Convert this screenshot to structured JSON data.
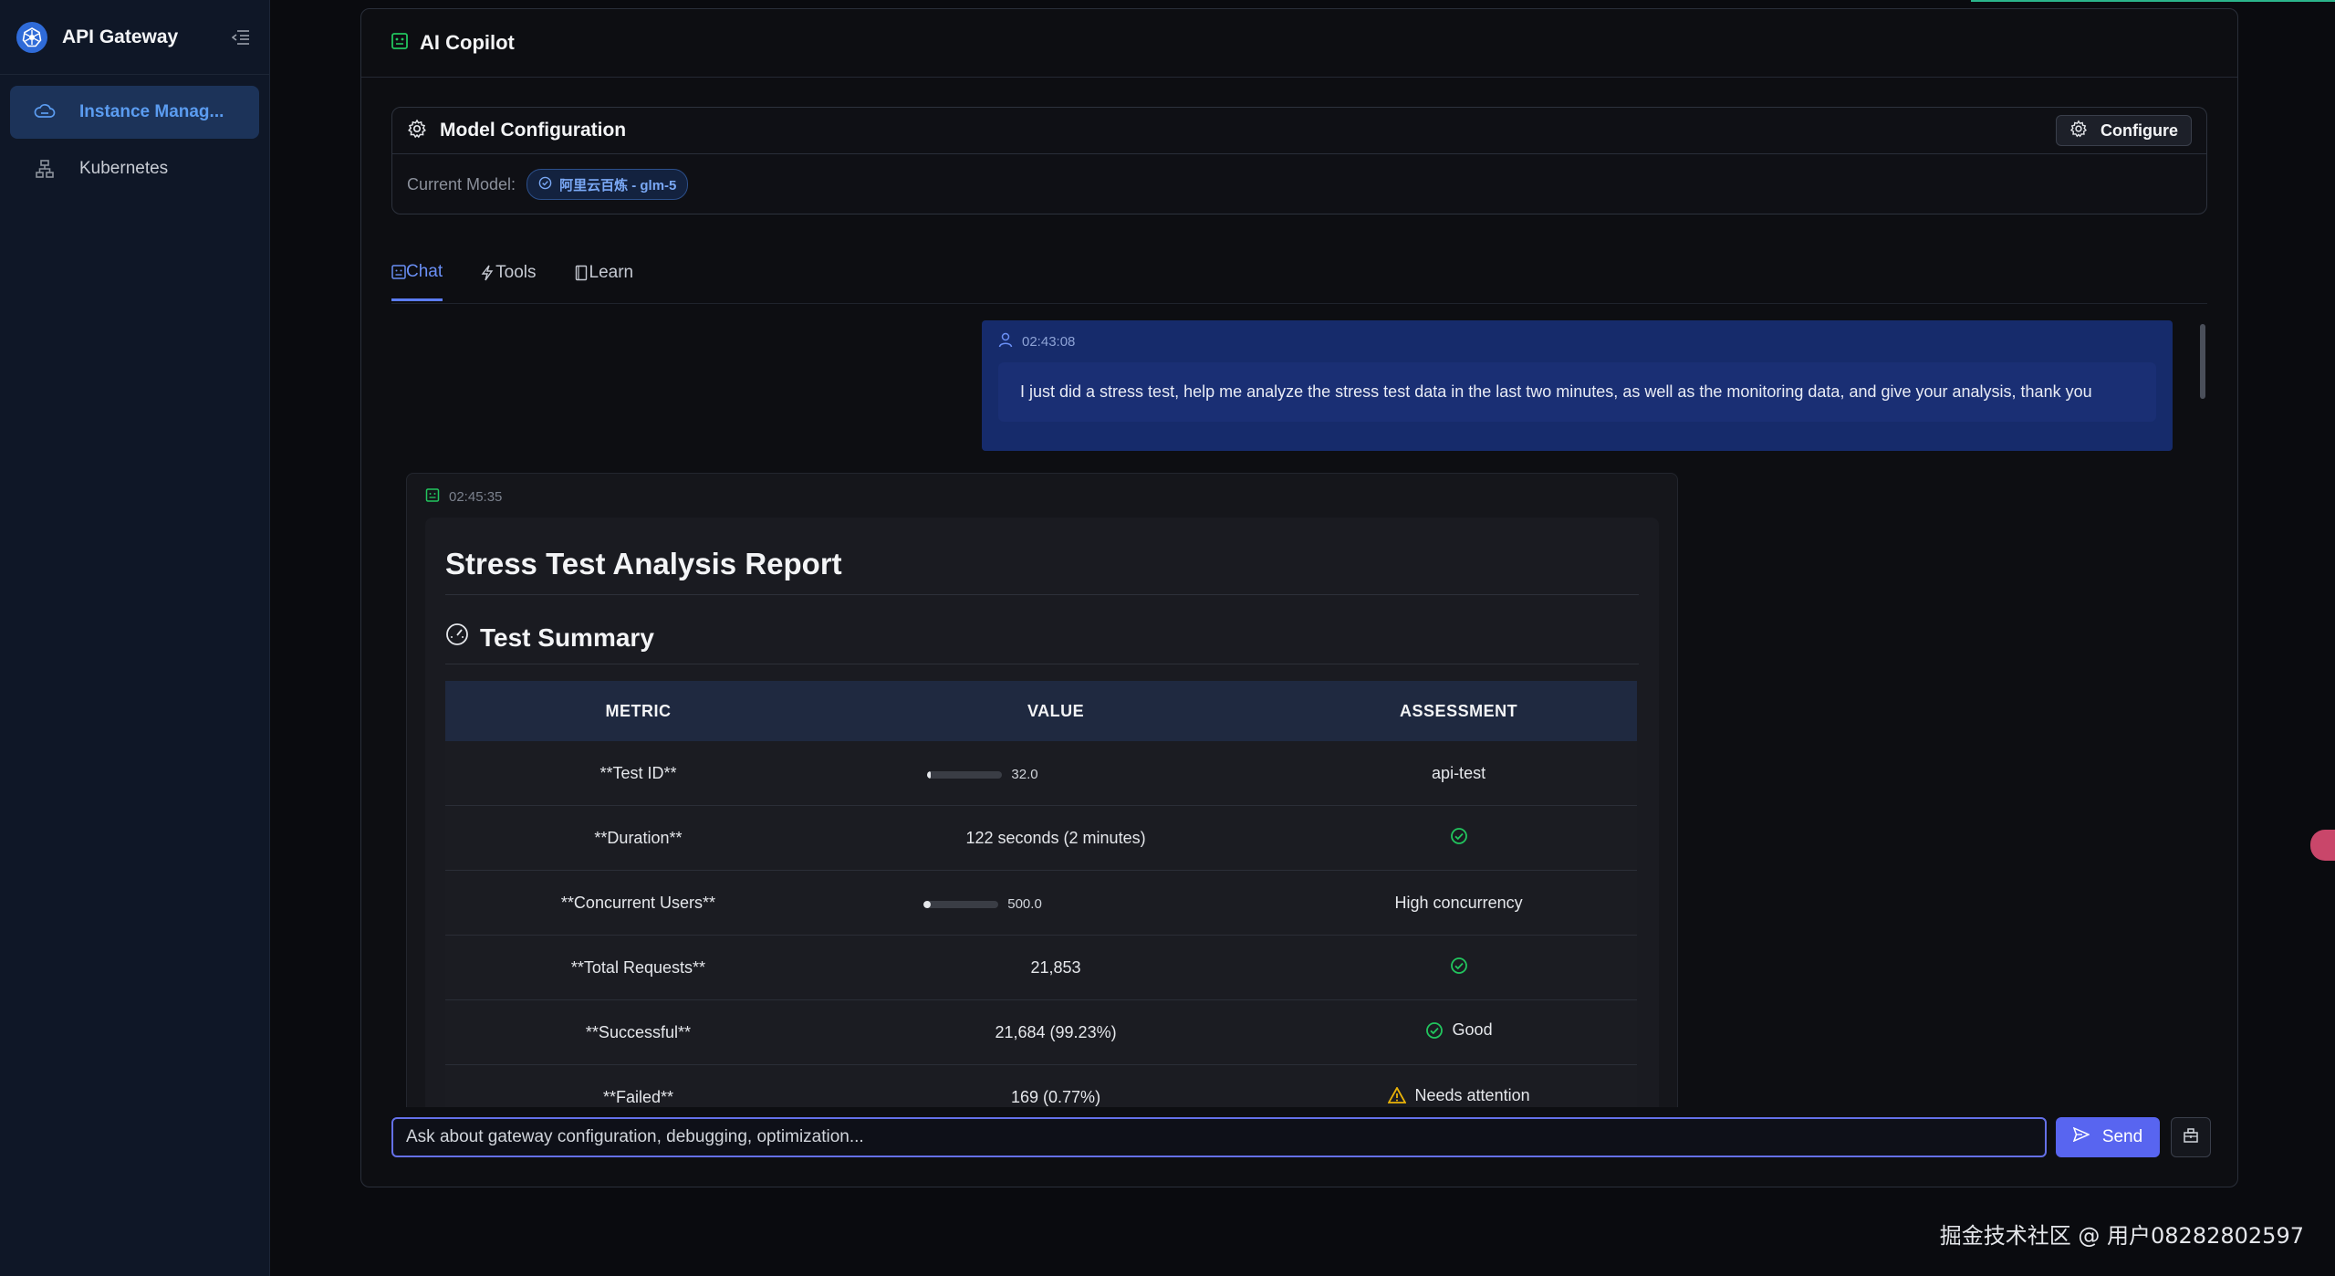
{
  "app": {
    "title": "API Gateway",
    "accent": "#5865f0"
  },
  "sidebar": {
    "items": [
      {
        "label": "Instance Manag...",
        "icon": "cloud-icon",
        "active": true
      },
      {
        "label": "Kubernetes",
        "icon": "cluster-icon",
        "active": false
      }
    ]
  },
  "panel": {
    "title": "AI Copilot"
  },
  "model_config": {
    "title": "Model Configuration",
    "configure_label": "Configure",
    "current_label": "Current Model:",
    "current_model": "阿里云百炼 - glm-5"
  },
  "tabs": [
    {
      "label": "Chat",
      "active": true
    },
    {
      "label": "Tools",
      "active": false
    },
    {
      "label": "Learn",
      "active": false
    }
  ],
  "messages": {
    "user": {
      "time": "02:43:08",
      "text": "I just did a stress test, help me analyze the stress test data in the last two minutes, as well as the monitoring data, and give your analysis, thank you"
    },
    "bot": {
      "time": "02:45:35",
      "report_title": "Stress Test Analysis Report",
      "section_title": "Test Summary",
      "table": {
        "headers": [
          "METRIC",
          "VALUE",
          "ASSESSMENT"
        ],
        "rows": [
          {
            "metric": "**Test ID**",
            "value": "32.0",
            "bar": 0.03,
            "assessment": "api-test",
            "assess_icon": ""
          },
          {
            "metric": "**Duration**",
            "value": "122 seconds (2 minutes)",
            "bar": null,
            "assessment": "",
            "assess_icon": "check-circle-icon"
          },
          {
            "metric": "**Concurrent Users**",
            "value": "500.0",
            "bar": 0.1,
            "assessment": "High concurrency",
            "assess_icon": ""
          },
          {
            "metric": "**Total Requests**",
            "value": "21,853",
            "bar": null,
            "assessment": "",
            "assess_icon": "check-circle-icon"
          },
          {
            "metric": "**Successful**",
            "value": "21,684 (99.23%)",
            "bar": null,
            "assessment": "Good",
            "assess_icon": "check-circle-icon"
          },
          {
            "metric": "**Failed**",
            "value": "169 (0.77%)",
            "bar": null,
            "assessment": "Needs attention",
            "assess_icon": "warning-icon"
          }
        ]
      }
    }
  },
  "input": {
    "placeholder": "Ask about gateway configuration, debugging, optimization...",
    "value": "",
    "send_label": "Send"
  },
  "watermark": "掘金技术社区 @ 用户08282802597"
}
